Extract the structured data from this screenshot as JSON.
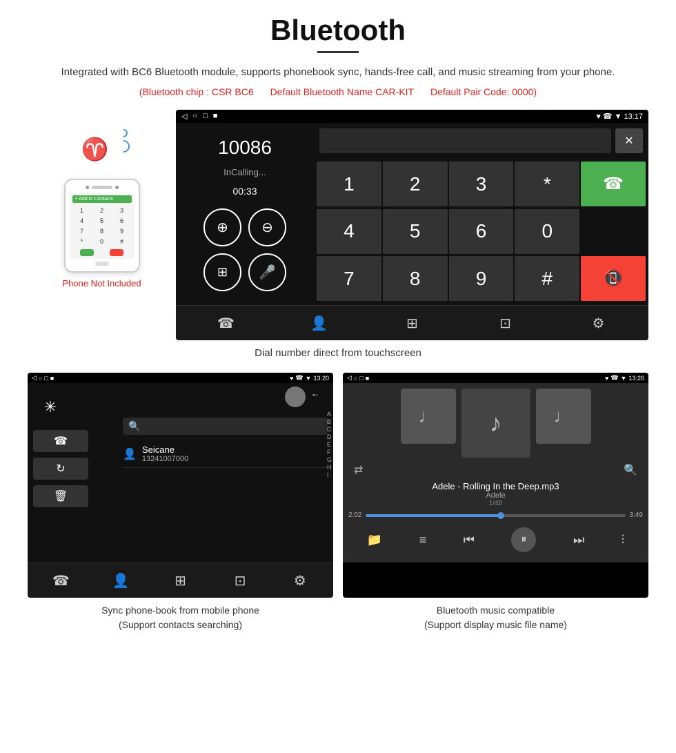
{
  "page": {
    "title": "Bluetooth",
    "description": "Integrated with BC6 Bluetooth module, supports phonebook sync, hands-free call, and music streaming from your phone.",
    "specs": {
      "chip": "(Bluetooth chip : CSR BC6",
      "name": "Default Bluetooth Name CAR-KIT",
      "code": "Default Pair Code: 0000)"
    }
  },
  "main_screen": {
    "status_bar": {
      "time": "13:17",
      "icons": "♥ ☎ ▼"
    },
    "dialer": {
      "number": "10086",
      "status": "InCalling...",
      "timer": "00:33"
    },
    "keypad": {
      "keys": [
        "1",
        "2",
        "3",
        "*",
        "4",
        "5",
        "6",
        "0",
        "7",
        "8",
        "9",
        "#"
      ]
    }
  },
  "phone_mockup": {
    "add_contact": "+ Add to Contacts",
    "keys": [
      "1",
      "2",
      "3",
      "4",
      "5",
      "6",
      "7",
      "8",
      "9",
      "*",
      "0",
      "#"
    ]
  },
  "phone_label": {
    "not_included": "Phone Not Included"
  },
  "caption_main": "Dial number direct from touchscreen",
  "phonebook_screen": {
    "status_time": "13:20",
    "contact_name": "Seicane",
    "contact_number": "13241007000",
    "alphabet": [
      "A",
      "B",
      "C",
      "D",
      "E",
      "F",
      "G",
      "H",
      "I"
    ]
  },
  "music_screen": {
    "status_time": "13:26",
    "track_name": "Adele - Rolling In the Deep.mp3",
    "artist": "Adele",
    "track_num": "1/48",
    "time_current": "2:02",
    "time_total": "3:49",
    "progress_pct": 52
  },
  "caption_phonebook": {
    "line1": "Sync phone-book from mobile phone",
    "line2": "(Support contacts searching)"
  },
  "caption_music": {
    "line1": "Bluetooth music compatible",
    "line2": "(Support display music file name)"
  }
}
